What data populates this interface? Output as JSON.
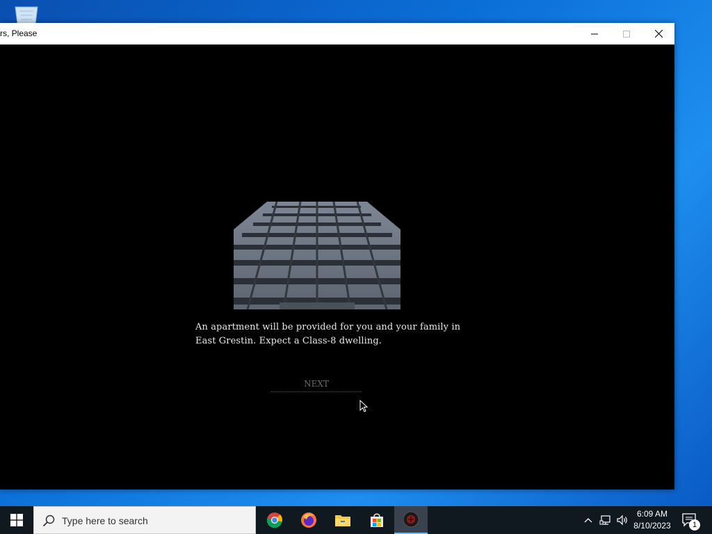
{
  "window": {
    "title": "rs, Please"
  },
  "game": {
    "message_line1": "An apartment will be provided for you and your family in",
    "message_line2": "East Grestin. Expect a Class-8 dwelling.",
    "next_label": "NEXT"
  },
  "taskbar": {
    "search_placeholder": "Type here to search",
    "apps": [
      {
        "name": "chrome-icon",
        "active": false
      },
      {
        "name": "firefox-icon",
        "active": false
      },
      {
        "name": "file-explorer-icon",
        "active": false
      },
      {
        "name": "microsoft-store-icon",
        "active": false
      },
      {
        "name": "papers-please-icon",
        "active": true
      }
    ],
    "clock_time": "6:09 AM",
    "clock_date": "8/10/2023",
    "notification_count": "1"
  },
  "colors": {
    "desktop_accent": "#0b6fd8",
    "taskbar_bg": "#101820",
    "active_underline": "#76b9ed"
  }
}
